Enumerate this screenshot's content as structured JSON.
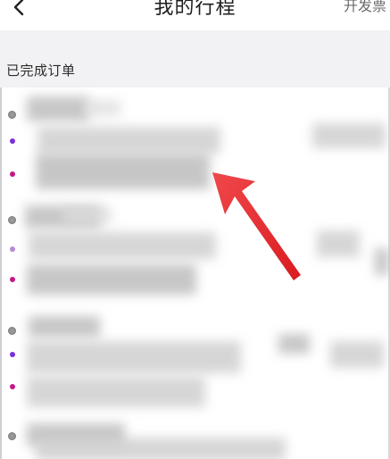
{
  "header": {
    "back_icon": "chevron-left-icon",
    "title": "我的行程",
    "action_label": "开发票"
  },
  "section": {
    "label": "已完成订单"
  },
  "orders": [
    {
      "icon_time": "clock-icon",
      "icon_start": "purple-dot-icon",
      "icon_end": "magenta-dot-icon"
    },
    {
      "icon_time": "clock-icon",
      "icon_start": "purple-dot-icon",
      "icon_end": "magenta-dot-icon"
    },
    {
      "icon_time": "clock-icon",
      "icon_start": "purple-dot-icon",
      "icon_end": "magenta-dot-icon"
    },
    {
      "icon_time": "clock-icon"
    }
  ],
  "annotation": {
    "arrow_color": "#e8262a"
  },
  "colors": {
    "start_dot": "#7b2fd6",
    "end_dot": "#c2188a",
    "strip_bg": "#f2f2f4"
  }
}
